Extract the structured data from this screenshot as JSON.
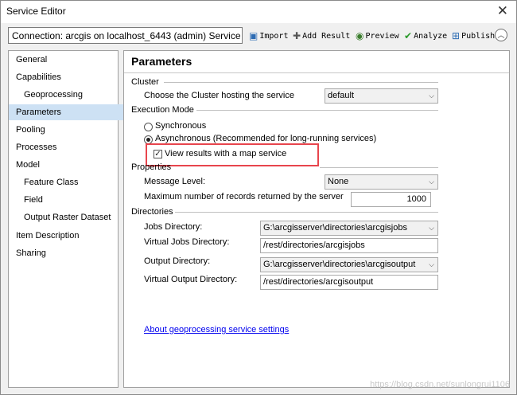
{
  "window": {
    "title": "Service Editor",
    "close_glyph": "✕"
  },
  "toolbar": {
    "connection": "Connection: arcgis on localhost_6443 (admin)   Service N...",
    "buttons": [
      {
        "icon": "import-icon",
        "label": "Import"
      },
      {
        "icon": "add-result-icon",
        "label": "Add Result"
      },
      {
        "icon": "preview-icon",
        "label": "Preview"
      },
      {
        "icon": "analyze-icon",
        "label": "Analyze"
      },
      {
        "icon": "publish-icon",
        "label": "Publish"
      }
    ],
    "collapse_icon": "collapse-up-icon"
  },
  "sidebar": {
    "items": [
      {
        "label": "General",
        "indent": 0
      },
      {
        "label": "Capabilities",
        "indent": 0
      },
      {
        "label": "Geoprocessing",
        "indent": 1
      },
      {
        "label": "Parameters",
        "indent": 0,
        "selected": true
      },
      {
        "label": "Pooling",
        "indent": 0
      },
      {
        "label": "Processes",
        "indent": 0
      },
      {
        "label": "Model",
        "indent": 0
      },
      {
        "label": "Feature Class",
        "indent": 1
      },
      {
        "label": "Field",
        "indent": 1
      },
      {
        "label": "Output Raster Dataset",
        "indent": 1
      },
      {
        "label": "Item Description",
        "indent": 0
      },
      {
        "label": "Sharing",
        "indent": 0
      }
    ]
  },
  "main": {
    "heading": "Parameters",
    "cluster": {
      "section": "Cluster",
      "label": "Choose the Cluster hosting the service",
      "value": "default"
    },
    "execution": {
      "section": "Execution Mode",
      "sync_label": "Synchronous",
      "async_label": "Asynchronous (Recommended for long-running services)",
      "mode": "asynchronous",
      "map_service_label": "View results with a map service",
      "map_service_checked": true
    },
    "properties": {
      "section": "Properties",
      "message_level_label": "Message Level:",
      "message_level_value": "None",
      "max_records_label": "Maximum number of records returned by the server",
      "max_records_value": "1000"
    },
    "directories": {
      "section": "Directories",
      "jobs_label": "Jobs Directory:",
      "jobs_value": "G:\\arcgisserver\\directories\\arcgisjobs",
      "virtual_jobs_label": "Virtual Jobs Directory:",
      "virtual_jobs_value": "/rest/directories/arcgisjobs",
      "output_label": "Output Directory:",
      "output_value": "G:\\arcgisserver\\directories\\arcgisoutput",
      "virtual_output_label": "Virtual Output Directory:",
      "virtual_output_value": "/rest/directories/arcgisoutput"
    },
    "link": "About geoprocessing service settings"
  },
  "watermark": "https://blog.csdn.net/sunlongrui1106",
  "colors": {
    "highlight": "#e8454d",
    "selection": "#cde1f4",
    "link": "#0000ee"
  }
}
